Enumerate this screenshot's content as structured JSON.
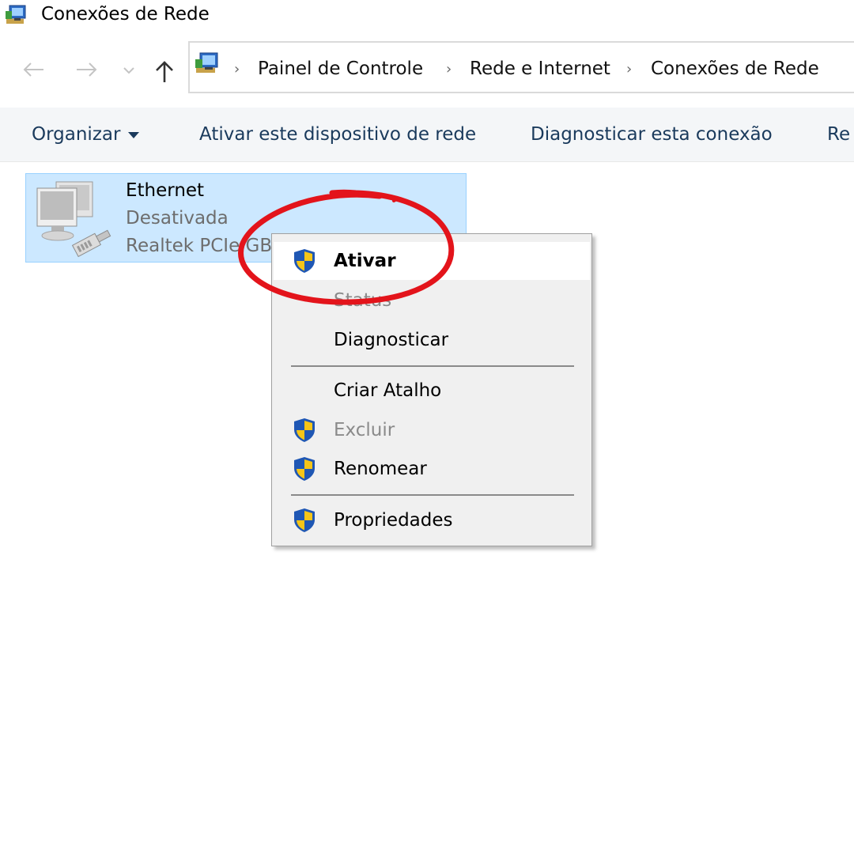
{
  "window": {
    "title": "Conexões de Rede"
  },
  "address_bar": {
    "breadcrumbs": [
      "Painel de Controle",
      "Rede e Internet",
      "Conexões de Rede"
    ]
  },
  "toolbar": {
    "organize_label": "Organizar",
    "enable_label": "Ativar este dispositivo de rede",
    "diagnose_label": "Diagnosticar esta conexão",
    "rename_label_partial": "Re"
  },
  "connection": {
    "name": "Ethernet",
    "status": "Desativada",
    "adapter": "Realtek PCIe GB"
  },
  "context_menu": {
    "items": [
      {
        "label": "Ativar",
        "icon": "uac-shield-icon",
        "bold": true,
        "highlighted": true,
        "enabled": true
      },
      {
        "label": "Status",
        "icon": null,
        "bold": false,
        "highlighted": false,
        "enabled": false
      },
      {
        "label": "Diagnosticar",
        "icon": null,
        "bold": false,
        "highlighted": false,
        "enabled": true
      },
      {
        "label": "Criar Atalho",
        "icon": null,
        "bold": false,
        "highlighted": false,
        "enabled": true
      },
      {
        "label": "Excluir",
        "icon": "uac-shield-icon",
        "bold": false,
        "highlighted": false,
        "enabled": false
      },
      {
        "label": "Renomear",
        "icon": "uac-shield-icon",
        "bold": false,
        "highlighted": false,
        "enabled": true
      },
      {
        "label": "Propriedades",
        "icon": "uac-shield-icon",
        "bold": false,
        "highlighted": false,
        "enabled": true
      }
    ]
  },
  "colors": {
    "selection_bg": "#cce8ff",
    "selection_border": "#99d1ff",
    "toolbar_bg": "#f4f6f8",
    "menu_bg": "#f0f0f0",
    "annotation_red": "#e3141b",
    "shield_blue": "#1f57b4",
    "shield_yellow": "#f5c518"
  }
}
